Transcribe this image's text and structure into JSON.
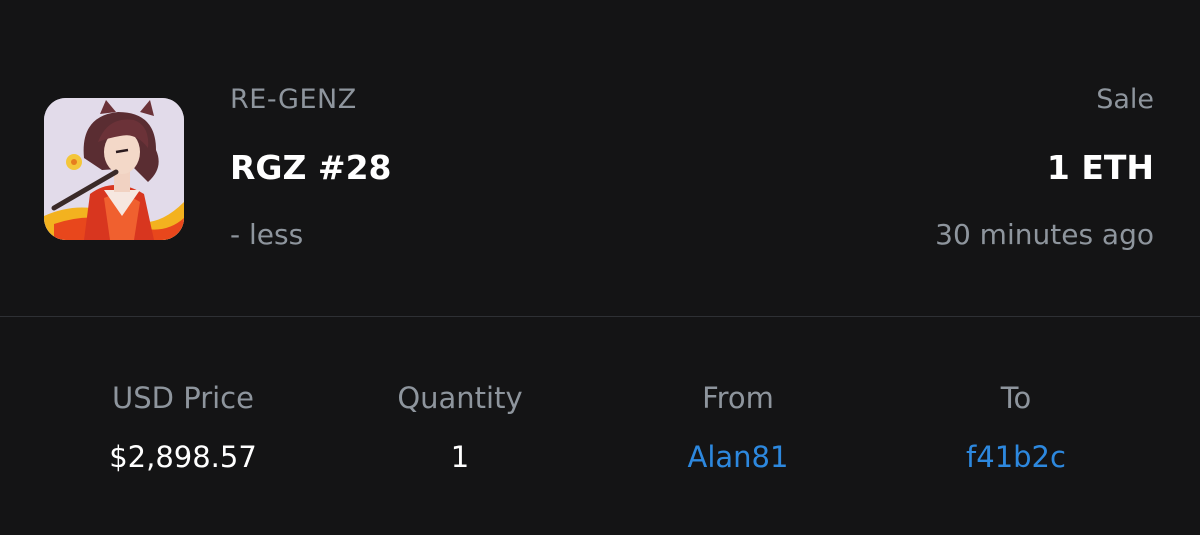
{
  "item": {
    "collection": "RE-GENZ",
    "name": "RGZ #28",
    "toggle_label": "- less",
    "thumbnail_icon": "nft-artwork-thumbnail"
  },
  "event": {
    "type": "Sale",
    "price": "1 ETH",
    "time": "30 minutes ago"
  },
  "details": {
    "usd_price_label": "USD Price",
    "usd_price_value": "$2,898.57",
    "quantity_label": "Quantity",
    "quantity_value": "1",
    "from_label": "From",
    "from_value": "Alan81",
    "to_label": "To",
    "to_value": "f41b2c"
  },
  "colors": {
    "background": "#141415",
    "muted_text": "#8e959d",
    "primary_text": "#ffffff",
    "link": "#2d88de",
    "divider": "#2e3034"
  }
}
